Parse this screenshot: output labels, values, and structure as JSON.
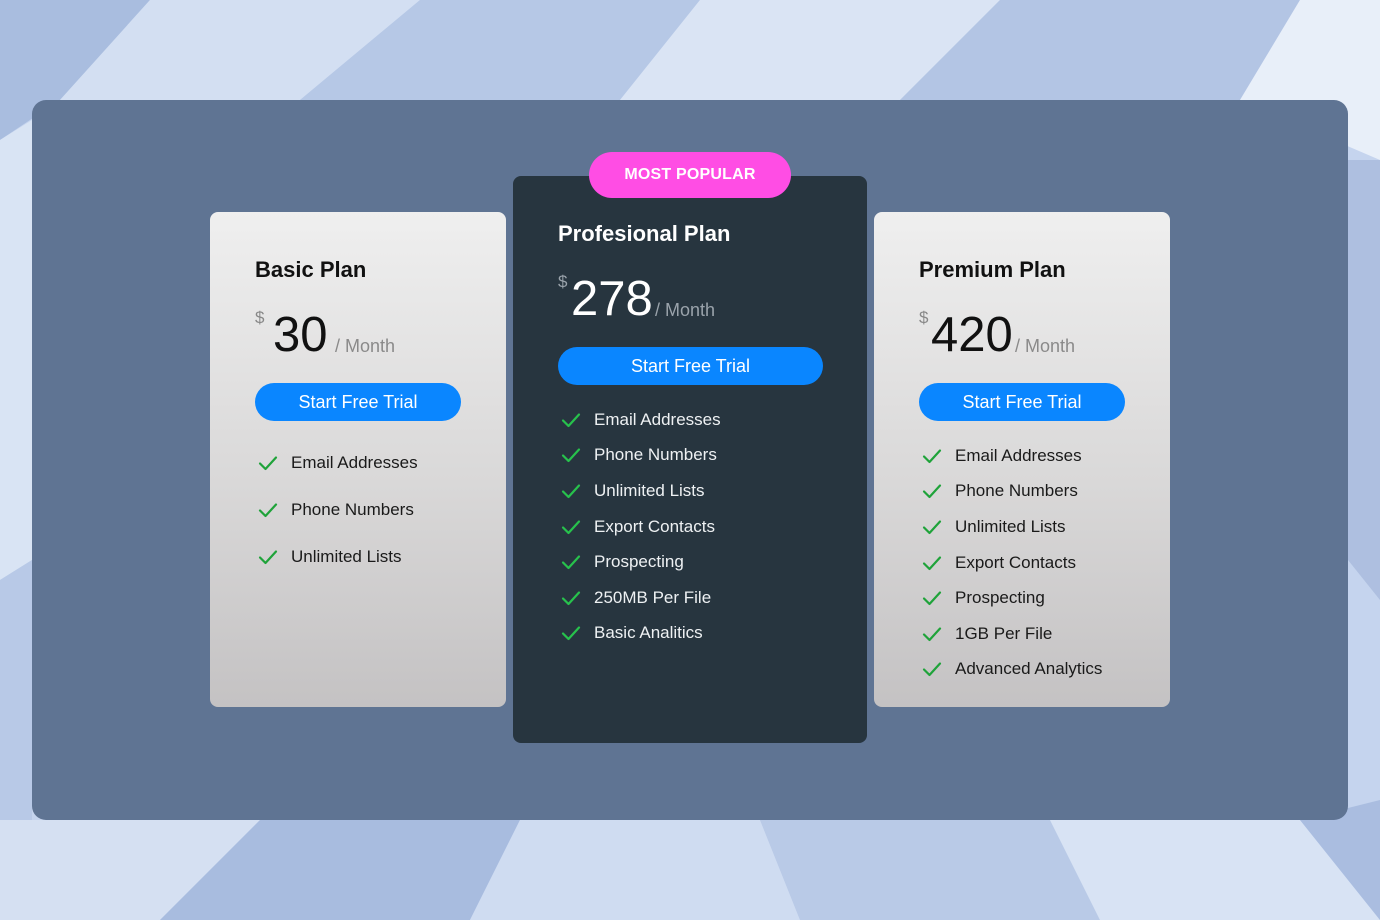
{
  "colors": {
    "accent_blue": "#0a86ff",
    "badge_pink": "#ff4de4",
    "check_green": "#1fa33a",
    "panel": "#5f7493",
    "dark_card": "#27353f"
  },
  "badge": {
    "label": "MOST POPULAR"
  },
  "plans": [
    {
      "title": "Basic Plan",
      "currency": "$",
      "amount": "30",
      "period": "/ Month",
      "cta": "Start Free Trial",
      "features": [
        "Email Addresses",
        "Phone Numbers",
        "Unlimited Lists"
      ]
    },
    {
      "title": "Profesional Plan",
      "currency": "$",
      "amount": "278",
      "period": "/ Month",
      "cta": "Start Free Trial",
      "features": [
        "Email Addresses",
        "Phone Numbers",
        "Unlimited Lists",
        "Export Contacts",
        "Prospecting",
        "250MB Per File",
        "Basic Analitics"
      ]
    },
    {
      "title": "Premium Plan",
      "currency": "$",
      "amount": "420",
      "period": "/ Month",
      "cta": "Start Free Trial",
      "features": [
        "Email Addresses",
        "Phone Numbers",
        "Unlimited Lists",
        "Export Contacts",
        "Prospecting",
        "1GB Per File",
        "Advanced Analytics"
      ]
    }
  ],
  "icons": {
    "feature_check": "check-icon"
  }
}
